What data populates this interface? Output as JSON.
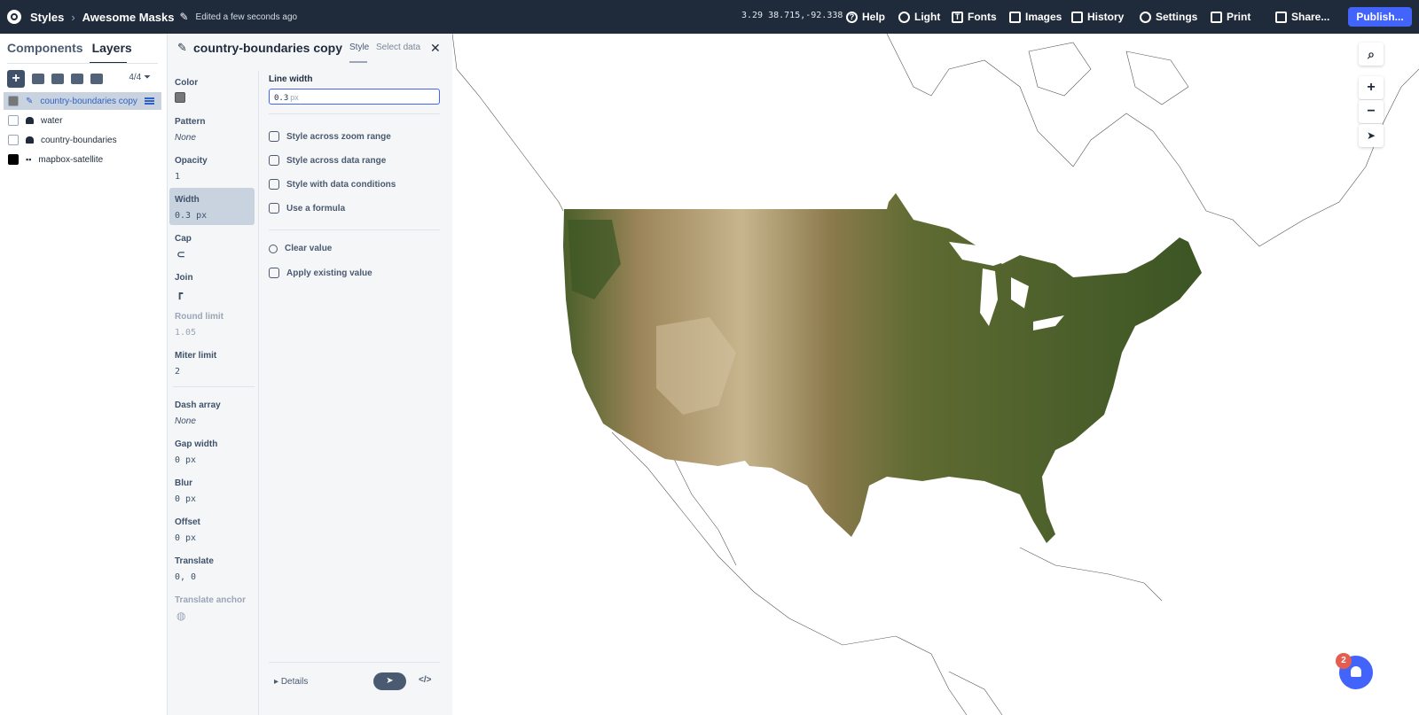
{
  "topbar": {
    "breadcrumb_root": "Styles",
    "style_name": "Awesome Masks",
    "edited": "Edited a few seconds ago",
    "coords": "3.29 38.715,-92.338",
    "menu": {
      "help": "Help",
      "light": "Light",
      "fonts": "Fonts",
      "images": "Images",
      "history": "History",
      "settings": "Settings",
      "print": "Print",
      "share": "Share...",
      "publish": "Publish..."
    }
  },
  "sidebar": {
    "tabs": [
      "Components",
      "Layers"
    ],
    "count": "4/4",
    "layers": [
      {
        "name": "country-boundaries copy",
        "selected": true,
        "swatch": "#777777",
        "icon": "pencil-icon"
      },
      {
        "name": "water",
        "selected": false,
        "swatch": "#ffffff",
        "icon": "fill-icon"
      },
      {
        "name": "country-boundaries",
        "selected": false,
        "swatch": "#ffffff",
        "icon": "fill-icon"
      },
      {
        "name": "mapbox-satellite",
        "selected": false,
        "swatch": "#000000",
        "icon": "raster-icon"
      }
    ]
  },
  "panel": {
    "title": "country-boundaries copy",
    "tab_style": "Style",
    "tab_data": "Select data",
    "properties": {
      "color": {
        "label": "Color"
      },
      "pattern": {
        "label": "Pattern",
        "value": "None"
      },
      "opacity": {
        "label": "Opacity",
        "value": "1"
      },
      "width": {
        "label": "Width",
        "value": "0.3 px"
      },
      "cap": {
        "label": "Cap"
      },
      "join": {
        "label": "Join"
      },
      "round_limit": {
        "label": "Round limit",
        "value": "1.05"
      },
      "miter_limit": {
        "label": "Miter limit",
        "value": "2"
      },
      "dash_array": {
        "label": "Dash array",
        "value": "None"
      },
      "gap_width": {
        "label": "Gap width",
        "value": "0 px"
      },
      "blur": {
        "label": "Blur",
        "value": "0 px"
      },
      "offset": {
        "label": "Offset",
        "value": "0 px"
      },
      "translate": {
        "label": "Translate",
        "value": "0, 0"
      },
      "translate_anchor": {
        "label": "Translate anchor"
      }
    },
    "editor": {
      "label": "Line width",
      "value": "0.3",
      "unit": "px",
      "options": [
        "Style across zoom range",
        "Style across data range",
        "Style with data conditions",
        "Use a formula"
      ],
      "actions": [
        "Clear value",
        "Apply existing value"
      ]
    },
    "footer": {
      "details": "Details"
    }
  },
  "map": {
    "controls": [
      "search",
      "zoom-in",
      "zoom-out",
      "compass"
    ],
    "notification_count": "2",
    "colors": {
      "land_dark": "#3f5a26",
      "land_light": "#a88e61",
      "desert": "#d4c3a0"
    }
  }
}
